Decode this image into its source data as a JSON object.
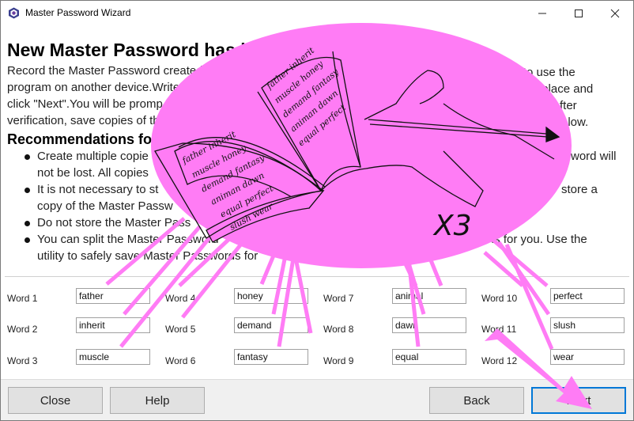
{
  "window": {
    "title": "Master Password Wizard",
    "minimize_icon": "minimize-icon",
    "maximize_icon": "maximize-icon",
    "close_icon": "close-icon"
  },
  "content": {
    "heading": "New Master Password has bee",
    "paragraph_lines": [
      "Record the Master Password created by",
      "program on another device.Write",
      "click \"Next\".You will be promp",
      "verification, save copies of th"
    ],
    "paragraph_right_lines": [
      "want to use the",
      "one place and",
      "After",
      "elow."
    ],
    "recommendations_title": "Recommendations fo",
    "recommendations": [
      {
        "left": "Create multiple copie",
        "right": "word will",
        "cont": "not be lost. All copies"
      },
      {
        "left": "It is not necessary to st",
        "right": "store a",
        "cont": "copy of the Master Passw"
      },
      {
        "left": "Do not store the Master Pass",
        "right": "",
        "cont": ""
      },
      {
        "left": "You can split the Master Password",
        "right": "ts for you. Use the",
        "cont": "utility to safely save Master Passwords for"
      }
    ]
  },
  "words": [
    {
      "label": "Word 1",
      "value": "father"
    },
    {
      "label": "Word 2",
      "value": "inherit"
    },
    {
      "label": "Word 3",
      "value": "muscle"
    },
    {
      "label": "Word 4",
      "value": "honey"
    },
    {
      "label": "Word 5",
      "value": "demand"
    },
    {
      "label": "Word 6",
      "value": "fantasy"
    },
    {
      "label": "Word 7",
      "value": "animal"
    },
    {
      "label": "Word 8",
      "value": "dawn"
    },
    {
      "label": "Word 9",
      "value": "equal"
    },
    {
      "label": "Word 10",
      "value": "perfect"
    },
    {
      "label": "Word 11",
      "value": "slush"
    },
    {
      "label": "Word 12",
      "value": "wear"
    }
  ],
  "buttons": {
    "close": "Close",
    "help": "Help",
    "back": "Back",
    "next": "Next"
  },
  "illustration": {
    "notebook_words": [
      "father inherit",
      "muscle honey",
      "demand fantasy",
      "animan dawn",
      "equal perfect",
      "slush wear"
    ],
    "caption": "X3"
  },
  "colors": {
    "overlay_pink": "#ff7cf5",
    "accent_blue": "#0078d7"
  }
}
